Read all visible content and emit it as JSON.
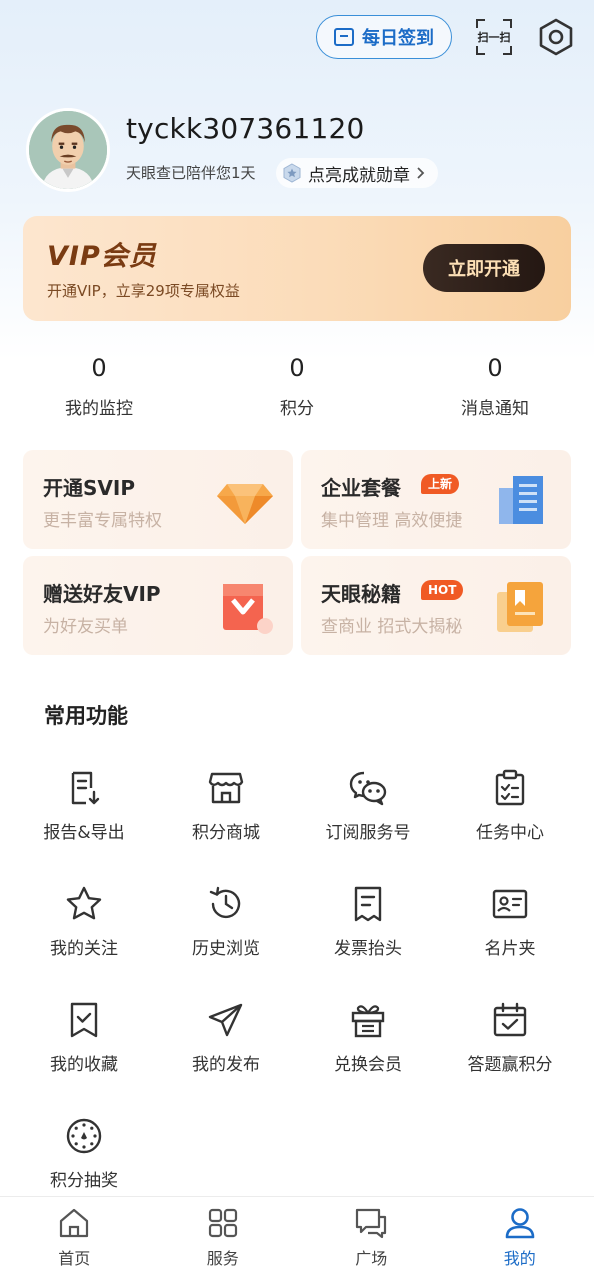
{
  "header": {
    "checkin_label": "每日签到",
    "scan_label": "扫一扫"
  },
  "profile": {
    "username": "tyckk307361120",
    "accompany_text": "天眼查已陪伴您1天",
    "achievement_label": "点亮成就勋章"
  },
  "vip": {
    "title": "VIP会员",
    "subtitle": "开通VIP，立享29项专属权益",
    "button_label": "立即开通"
  },
  "stats": [
    {
      "value": "0",
      "label": "我的监控"
    },
    {
      "value": "0",
      "label": "积分"
    },
    {
      "value": "0",
      "label": "消息通知"
    }
  ],
  "promos": [
    {
      "title": "开通SVIP",
      "subtitle": "更丰富专属特权",
      "tag": ""
    },
    {
      "title": "企业套餐",
      "subtitle": "集中管理 高效便捷",
      "tag": "上新"
    },
    {
      "title": "赠送好友VIP",
      "subtitle": "为好友买单",
      "tag": ""
    },
    {
      "title": "天眼秘籍",
      "subtitle": "查商业 招式大揭秘",
      "tag": "HOT"
    }
  ],
  "common": {
    "title": "常用功能",
    "items": [
      {
        "label": "报告&导出",
        "icon": "report-export-icon"
      },
      {
        "label": "积分商城",
        "icon": "store-icon"
      },
      {
        "label": "订阅服务号",
        "icon": "wechat-icon"
      },
      {
        "label": "任务中心",
        "icon": "clipboard-icon"
      },
      {
        "label": "我的关注",
        "icon": "star-icon"
      },
      {
        "label": "历史浏览",
        "icon": "history-icon"
      },
      {
        "label": "发票抬头",
        "icon": "invoice-icon"
      },
      {
        "label": "名片夹",
        "icon": "business-card-icon"
      },
      {
        "label": "我的收藏",
        "icon": "bookmark-icon"
      },
      {
        "label": "我的发布",
        "icon": "send-icon"
      },
      {
        "label": "兑换会员",
        "icon": "gift-icon"
      },
      {
        "label": "答题赢积分",
        "icon": "calendar-check-icon"
      },
      {
        "label": "积分抽奖",
        "icon": "lottery-wheel-icon"
      }
    ]
  },
  "nav": [
    {
      "label": "首页",
      "icon": "home-icon"
    },
    {
      "label": "服务",
      "icon": "grid-icon"
    },
    {
      "label": "广场",
      "icon": "chat-icon"
    },
    {
      "label": "我的",
      "icon": "user-icon"
    }
  ],
  "colors": {
    "accent": "#1c6cc7",
    "vip_text": "#7a3b12",
    "tag": "#f05a24"
  }
}
